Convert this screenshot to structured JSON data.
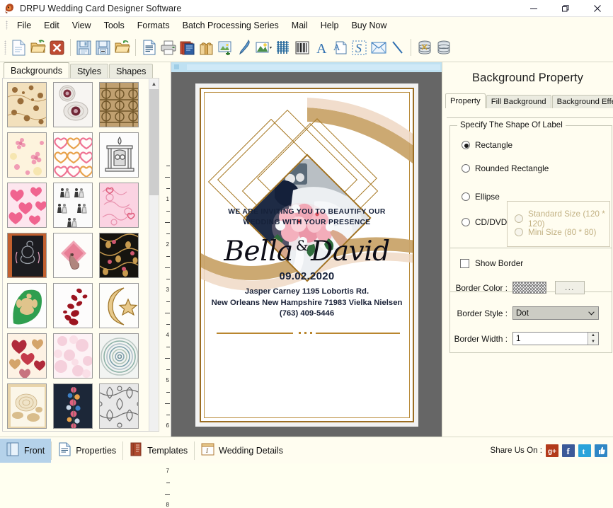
{
  "window": {
    "title": "DRPU Wedding Card Designer Software",
    "app_icon": "app-logo-icon",
    "minimize": "–",
    "restore": "❐",
    "close": "✕"
  },
  "menu": {
    "items": [
      {
        "label": "File"
      },
      {
        "label": "Edit"
      },
      {
        "label": "View"
      },
      {
        "label": "Tools"
      },
      {
        "label": "Formats"
      },
      {
        "label": "Batch Processing Series"
      },
      {
        "label": "Mail"
      },
      {
        "label": "Help"
      },
      {
        "label": "Buy Now"
      }
    ]
  },
  "toolbar": {
    "groups": [
      [
        "new-document-icon",
        "open-folder-icon",
        "close-document-icon"
      ],
      [
        "save-icon",
        "save-as-icon",
        "open-project-icon"
      ],
      [
        "page-setup-icon",
        "print-icon",
        "print-preview-icon",
        "gift-card-icon",
        "insert-image-icon",
        "pen-tool-icon",
        "picture-shape-icon",
        "barcode-grid-icon",
        "barcode-icon",
        "text-tool-icon",
        "text-watermark-icon",
        "signature-icon",
        "email-icon",
        "line-tool-icon"
      ],
      [
        "database-icon",
        "database-stack-icon"
      ]
    ]
  },
  "left_panel": {
    "tabs": [
      {
        "label": "Backgrounds",
        "active": true
      },
      {
        "label": "Styles",
        "active": false
      },
      {
        "label": "Shapes",
        "active": false
      }
    ],
    "thumbnails": [
      {
        "name": "brown-floral-pattern"
      },
      {
        "name": "lace-doily-brooch"
      },
      {
        "name": "gold-geometric-lattice"
      },
      {
        "name": "pink-blossom-cream"
      },
      {
        "name": "outlined-hearts-row"
      },
      {
        "name": "wedding-mandap-sketch"
      },
      {
        "name": "pink-hearts-scatter"
      },
      {
        "name": "wedding-couple-icons"
      },
      {
        "name": "pink-swirl-hearts"
      },
      {
        "name": "ganesha-orange-panel"
      },
      {
        "name": "pink-elephant-motif"
      },
      {
        "name": "black-gold-floral"
      },
      {
        "name": "green-leaf-ganesha"
      },
      {
        "name": "red-rose-petals"
      },
      {
        "name": "gold-crescent-star"
      },
      {
        "name": "glitter-hearts-red"
      },
      {
        "name": "soft-pink-marble"
      },
      {
        "name": "teal-mandala-circle"
      },
      {
        "name": "cream-rose-frame"
      },
      {
        "name": "navy-floral-border"
      },
      {
        "name": "grey-damask-pattern"
      }
    ],
    "scroll_up_glyph": "▲"
  },
  "ruler": {
    "vertical_marks": [
      "1",
      "2",
      "3",
      "4",
      "5",
      "6",
      "7",
      "8"
    ]
  },
  "card": {
    "photo_alt": "bride-groom-with-bouquet-photo",
    "invite_line1": "WE ARE  INVITING YOU  TO BEAUTIFY OUR",
    "invite_line2": "WEDDING WITH YOUR PRESENCE",
    "bride_name": "Bella",
    "ampersand": "&",
    "groom_name": "David",
    "date": "09.02.2020",
    "address_line1": "Jasper Carney 1195 Lobortis Rd.",
    "address_line2": "New Orleans New Hampshire 71983 Vielka Nielsen",
    "phone": "(763) 409-5446",
    "accent_gold": "#a5761f",
    "accent_tan": "#c9a46a"
  },
  "right_panel": {
    "title": "Background Property",
    "tabs": [
      {
        "label": "Property",
        "active": true
      },
      {
        "label": "Fill Background",
        "active": false
      },
      {
        "label": "Background Effects",
        "active": false
      }
    ],
    "shape_group": {
      "label": "Specify The Shape Of Label",
      "options": [
        {
          "label": "Rectangle",
          "selected": true,
          "disabled": false
        },
        {
          "label": "Rounded Rectangle",
          "selected": false,
          "disabled": false
        },
        {
          "label": "Ellipse",
          "selected": false,
          "disabled": false
        },
        {
          "label": "CD/DVD",
          "selected": false,
          "disabled": false
        }
      ],
      "cd_sizes": [
        {
          "label": "Standard Size (120 * 120)",
          "selected": false,
          "disabled": true
        },
        {
          "label": "Mini Size (80 * 80)",
          "selected": false,
          "disabled": true
        }
      ]
    },
    "border_group": {
      "show_border_label": "Show Border",
      "show_border_checked": false,
      "color_label": "Border Color :",
      "color_browse": "...",
      "style_label": "Border Style :",
      "style_value": "Dot",
      "width_label": "Border Width :",
      "width_value": "1",
      "dropdown_glyph": "⌄",
      "spin_up": "▲",
      "spin_down": "▼"
    }
  },
  "statusbar": {
    "buttons": [
      {
        "label": "Front",
        "icon": "card-front-icon",
        "active": true
      },
      {
        "label": "Properties",
        "icon": "properties-icon",
        "active": false
      },
      {
        "label": "Templates",
        "icon": "templates-book-icon",
        "active": false
      },
      {
        "label": "Wedding Details",
        "icon": "wedding-details-icon",
        "active": false
      }
    ],
    "share_label": "Share Us On :",
    "share_icons": [
      {
        "name": "google-plus-icon",
        "glyph": "g+",
        "color": "#b33a1a"
      },
      {
        "name": "facebook-icon",
        "glyph": "f",
        "color": "#3b5998"
      },
      {
        "name": "twitter-icon",
        "glyph": "t",
        "color": "#2aa3da"
      },
      {
        "name": "thumbs-up-icon",
        "glyph": "ὄD",
        "color": "#2f86c5"
      }
    ]
  }
}
